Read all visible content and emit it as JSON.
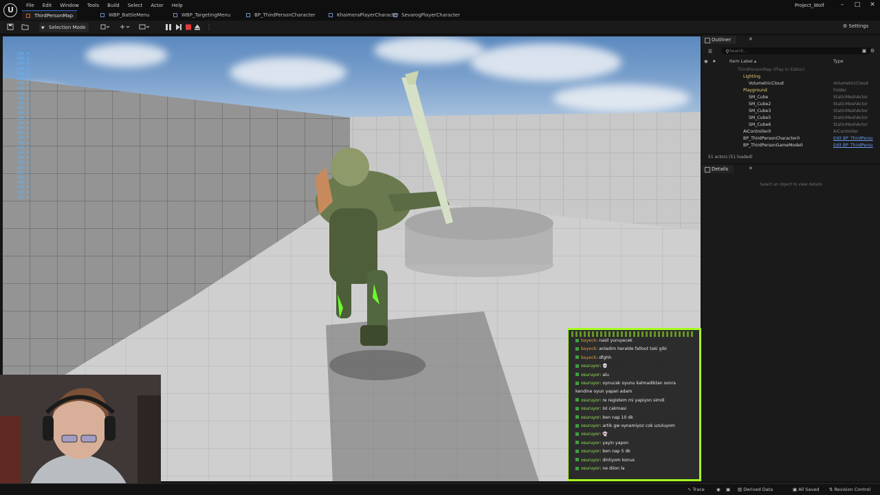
{
  "menu": [
    "File",
    "Edit",
    "Window",
    "Tools",
    "Build",
    "Select",
    "Actor",
    "Help"
  ],
  "tabs": [
    "ThirdPersonMap",
    "WBP_BattleMenu",
    "WBP_TargetingMenu",
    "BP_ThirdPersonCharacter",
    "KhaimeraPlayerCharacter",
    "SevarogPlayerCharacter"
  ],
  "project_name": "Project_Wolf",
  "window_controls": [
    "–",
    "□",
    "✕"
  ],
  "toolbar": {
    "selection_mode": "Selection Mode",
    "settings": "Settings"
  },
  "stats_column": [
    "100.0",
    "100.0",
    "100.0",
    "100.0",
    "100.0",
    "100.0",
    "100.0",
    "100.0",
    "100.0",
    "100.0",
    "100.0",
    "100.0",
    "100.0",
    "100.0",
    "100.0",
    "100.0",
    "100.0",
    "100.0",
    "100.0",
    "100.0",
    "100.0",
    "100.0",
    "100.0",
    "100.0",
    "100.0",
    "100.0",
    "100.0",
    "100.0",
    "100.0",
    "100.0"
  ],
  "chat": [
    {
      "user": "bayeck",
      "text": ": nasil yuruyecek",
      "orange": true
    },
    {
      "user": "bayeck",
      "text": ": anladim heralde fallout taki gibi",
      "orange": true
    },
    {
      "user": "bayeck",
      "text": ": dfghh",
      "orange": true
    },
    {
      "user": "osuruyor",
      "text": ": 💀",
      "orange": false
    },
    {
      "user": "osuruyor",
      "text": ": alu",
      "orange": false
    },
    {
      "user": "osuruyor",
      "text": ": oynucak oyunu kalmadiktan sonra",
      "orange": false
    },
    {
      "user": "",
      "text": "kendine oyun yapan adam",
      "orange": false
    },
    {
      "user": "osuruyor",
      "text": ": re registem mi yapiyon simdi",
      "orange": false
    },
    {
      "user": "osuruyor",
      "text": ": lol cakmasi",
      "orange": false
    },
    {
      "user": "osuruyor",
      "text": ": ben nap 10 dk",
      "orange": false
    },
    {
      "user": "osuruyor",
      "text": ": artik gw oynamiyoz cok uzuluyom",
      "orange": false
    },
    {
      "user": "osuruyor",
      "text": ": 👻",
      "orange": false
    },
    {
      "user": "osuruyor",
      "text": ": yayin yapon",
      "orange": false
    },
    {
      "user": "osuruyor",
      "text": ": ben nap 5 dk",
      "orange": false
    },
    {
      "user": "osuruyor",
      "text": ": dinliyom konus",
      "orange": false
    },
    {
      "user": "osuruyor",
      "text": ": ne diion la",
      "orange": false
    }
  ],
  "outliner": {
    "tab": "Outliner",
    "search_placeholder": "Search...",
    "col_label": "Item Label ▴",
    "col_type": "Type",
    "rows": [
      {
        "label": "ThirdPersonMap (Play In Editor)",
        "type": "",
        "indent": 1,
        "style": "dim",
        "link": false
      },
      {
        "label": "Lighting",
        "type": "",
        "indent": 2,
        "style": "hl",
        "link": false
      },
      {
        "label": "VolumetricCloud",
        "type": "VolumetricCloud",
        "indent": 3,
        "style": "",
        "link": false
      },
      {
        "label": "Playground",
        "type": "Folder",
        "indent": 2,
        "style": "hl",
        "link": false
      },
      {
        "label": "SM_Cube",
        "type": "StaticMeshActor",
        "indent": 3,
        "style": "",
        "link": false
      },
      {
        "label": "SM_Cube2",
        "type": "StaticMeshActor",
        "indent": 3,
        "style": "",
        "link": false
      },
      {
        "label": "SM_Cube3",
        "type": "StaticMeshActor",
        "indent": 3,
        "style": "",
        "link": false
      },
      {
        "label": "SM_Cube5",
        "type": "StaticMeshActor",
        "indent": 3,
        "style": "",
        "link": false
      },
      {
        "label": "SM_Cube6",
        "type": "StaticMeshActor",
        "indent": 3,
        "style": "",
        "link": false
      },
      {
        "label": "AIController0",
        "type": "AIController",
        "indent": 2,
        "style": "",
        "link": false
      },
      {
        "label": "BP_ThirdPersonCharacter0",
        "type": "Edit BP_ThirdPerso",
        "indent": 2,
        "style": "",
        "link": true
      },
      {
        "label": "BP_ThirdPersonGameMode0",
        "type": "Edit BP_ThirdPerso",
        "indent": 2,
        "style": "",
        "link": true
      }
    ],
    "actor_count": "51 actors (51 loaded)"
  },
  "details": {
    "tab": "Details",
    "empty_text": "Select an object to view details"
  },
  "statusbar": {
    "trace": "Trace",
    "derived_data": "Derived Data",
    "all_saved": "All Saved",
    "revision_control": "Revision Control"
  }
}
